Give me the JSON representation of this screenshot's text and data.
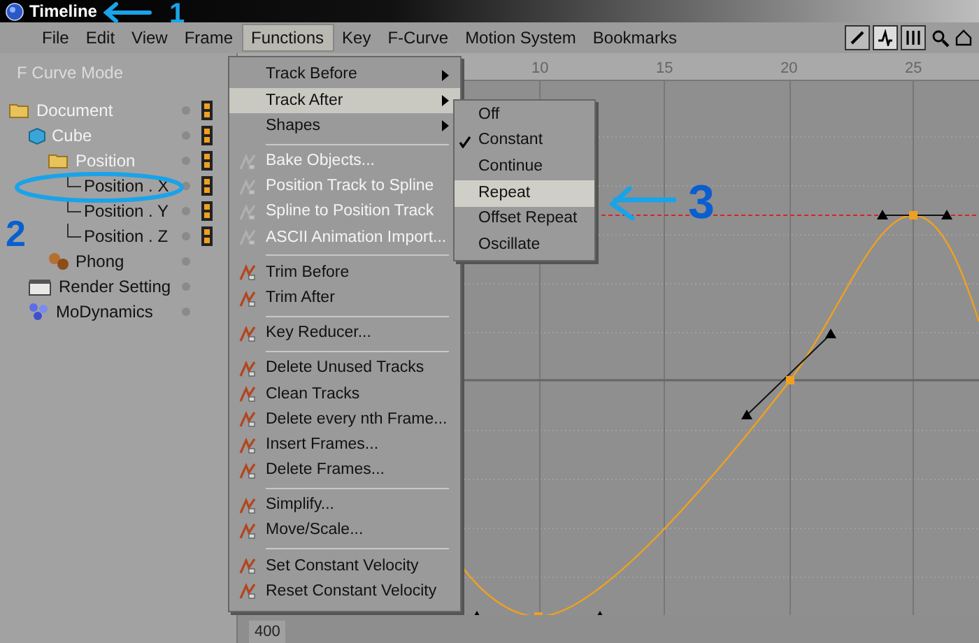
{
  "window": {
    "title": "Timeline"
  },
  "menu_bar": [
    {
      "label": "File",
      "selected": false
    },
    {
      "label": "Edit",
      "selected": false
    },
    {
      "label": "View",
      "selected": false
    },
    {
      "label": "Frame",
      "selected": false
    },
    {
      "label": "Functions",
      "selected": true
    },
    {
      "label": "Key",
      "selected": false
    },
    {
      "label": "F-Curve",
      "selected": false
    },
    {
      "label": "Motion System",
      "selected": false
    },
    {
      "label": "Bookmarks",
      "selected": false
    }
  ],
  "panel": {
    "mode_label": "F Curve Mode"
  },
  "tree": [
    {
      "label": "Document",
      "disabled": true,
      "kind": "folder",
      "track": true,
      "children": [
        {
          "label": "Cube",
          "disabled": true,
          "kind": "object",
          "track": true,
          "children": [
            {
              "label": "Position",
              "disabled": true,
              "kind": "folder",
              "track": true,
              "children": [
                {
                  "label": "Position . X",
                  "disabled": false,
                  "kind": "track",
                  "track": true
                },
                {
                  "label": "Position . Y",
                  "disabled": false,
                  "kind": "track",
                  "track": true
                },
                {
                  "label": "Position . Z",
                  "disabled": false,
                  "kind": "track",
                  "track": true
                }
              ]
            },
            {
              "label": "Phong",
              "disabled": false,
              "kind": "material",
              "track": false
            }
          ]
        },
        {
          "label": "Render Setting",
          "disabled": false,
          "kind": "settings",
          "track": false
        },
        {
          "label": "MoDynamics",
          "disabled": false,
          "kind": "dynamics",
          "track": false
        }
      ]
    }
  ],
  "functions_menu": [
    {
      "kind": "item",
      "label": "Track Before",
      "submenu": true,
      "disabled": false,
      "selected": false
    },
    {
      "kind": "item",
      "label": "Track After",
      "submenu": true,
      "disabled": false,
      "selected": true
    },
    {
      "kind": "item",
      "label": "Shapes",
      "submenu": true,
      "disabled": false,
      "selected": false
    },
    {
      "kind": "separator"
    },
    {
      "kind": "item",
      "label": "Bake Objects...",
      "submenu": false,
      "disabled": true,
      "selected": false
    },
    {
      "kind": "item",
      "label": "Position Track to Spline",
      "submenu": false,
      "disabled": true,
      "selected": false
    },
    {
      "kind": "item",
      "label": "Spline to Position Track",
      "submenu": false,
      "disabled": true,
      "selected": false
    },
    {
      "kind": "item",
      "label": "ASCII Animation Import...",
      "submenu": false,
      "disabled": true,
      "selected": false
    },
    {
      "kind": "separator"
    },
    {
      "kind": "item",
      "label": "Trim Before",
      "submenu": false,
      "disabled": false,
      "selected": false
    },
    {
      "kind": "item",
      "label": "Trim After",
      "submenu": false,
      "disabled": false,
      "selected": false
    },
    {
      "kind": "separator"
    },
    {
      "kind": "item",
      "label": "Key Reducer...",
      "submenu": false,
      "disabled": false,
      "selected": false
    },
    {
      "kind": "separator"
    },
    {
      "kind": "item",
      "label": "Delete Unused Tracks",
      "submenu": false,
      "disabled": false,
      "selected": false
    },
    {
      "kind": "item",
      "label": "Clean Tracks",
      "submenu": false,
      "disabled": false,
      "selected": false
    },
    {
      "kind": "item",
      "label": "Delete every nth Frame...",
      "submenu": false,
      "disabled": false,
      "selected": false
    },
    {
      "kind": "item",
      "label": "Insert Frames...",
      "submenu": false,
      "disabled": false,
      "selected": false
    },
    {
      "kind": "item",
      "label": "Delete Frames...",
      "submenu": false,
      "disabled": false,
      "selected": false
    },
    {
      "kind": "separator"
    },
    {
      "kind": "item",
      "label": "Simplify...",
      "submenu": false,
      "disabled": false,
      "selected": false
    },
    {
      "kind": "item",
      "label": "Move/Scale...",
      "submenu": false,
      "disabled": false,
      "selected": false
    },
    {
      "kind": "separator"
    },
    {
      "kind": "item",
      "label": "Set Constant Velocity",
      "submenu": false,
      "disabled": false,
      "selected": false
    },
    {
      "kind": "item",
      "label": "Reset Constant Velocity",
      "submenu": false,
      "disabled": false,
      "selected": false
    }
  ],
  "track_after_submenu": [
    {
      "label": "Off",
      "checked": false,
      "selected": false
    },
    {
      "label": "Constant",
      "checked": true,
      "selected": false
    },
    {
      "label": "Continue",
      "checked": false,
      "selected": false
    },
    {
      "label": "Repeat",
      "checked": false,
      "selected": true
    },
    {
      "label": "Offset Repeat",
      "checked": false,
      "selected": false
    },
    {
      "label": "Oscillate",
      "checked": false,
      "selected": false
    }
  ],
  "ruler_labels": [
    "10",
    "15",
    "20",
    "25"
  ],
  "value_label": "400",
  "annotations": [
    {
      "label": "1"
    },
    {
      "label": "2"
    },
    {
      "label": "3"
    }
  ]
}
